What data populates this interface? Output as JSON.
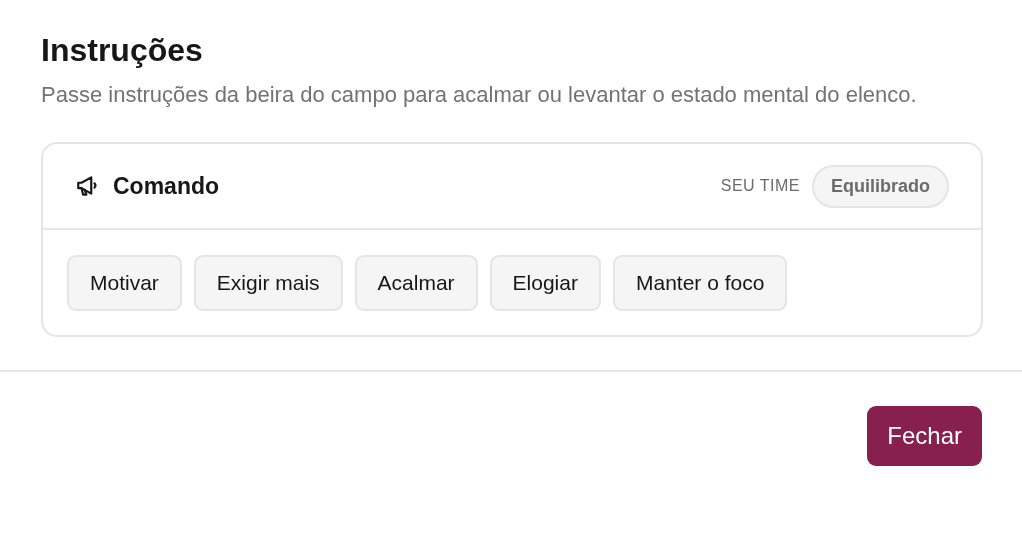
{
  "dialog": {
    "title": "Instruções",
    "description": "Passe instruções da beira do campo para acalmar ou levantar o estado mental do elenco.",
    "card": {
      "title": "Comando",
      "team_label": "SEU TIME",
      "team_state": "Equilibrado",
      "commands": [
        {
          "label": "Motivar"
        },
        {
          "label": "Exigir mais"
        },
        {
          "label": "Acalmar"
        },
        {
          "label": "Elogiar"
        },
        {
          "label": "Manter o foco"
        }
      ]
    },
    "buttons": [
      {
        "label": "Fechar",
        "kind": "primary"
      }
    ]
  }
}
